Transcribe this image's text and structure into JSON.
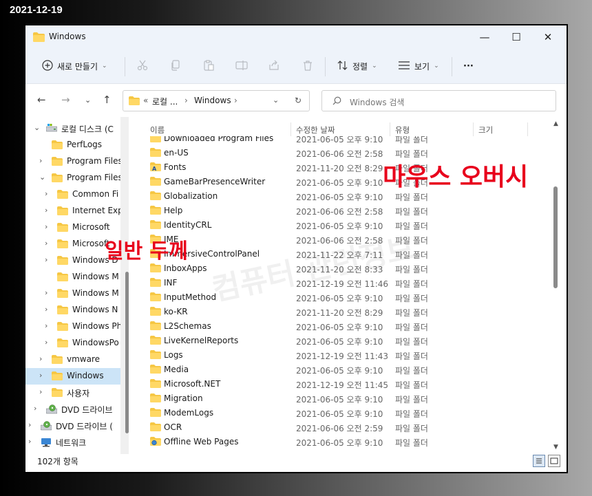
{
  "date_stamp": "2021-12-19",
  "window": {
    "title": "Windows",
    "controls": {
      "minimize": "—",
      "maximize": "☐",
      "close": "✕"
    }
  },
  "toolbar": {
    "new_label": "새로 만들기",
    "sort_label": "정렬",
    "view_label": "보기",
    "more_label": "···"
  },
  "address": {
    "overflow": "«",
    "parts": [
      "로컬 ...",
      "Windows"
    ],
    "search_placeholder": "Windows 검색"
  },
  "tree": [
    {
      "label": "로컬 디스크 (C",
      "icon": "drive-icon",
      "level": 0,
      "chev": "expanded"
    },
    {
      "label": "PerfLogs",
      "icon": "folder-icon",
      "level": 1,
      "chev": "none"
    },
    {
      "label": "Program Files",
      "icon": "folder-icon",
      "level": 1,
      "chev": "collapsed"
    },
    {
      "label": "Program Files",
      "icon": "folder-icon",
      "level": 1,
      "chev": "expanded"
    },
    {
      "label": "Common Fi",
      "icon": "folder-icon",
      "level": 2,
      "chev": "collapsed"
    },
    {
      "label": "Internet Exp",
      "icon": "folder-icon",
      "level": 2,
      "chev": "collapsed"
    },
    {
      "label": "Microsoft",
      "icon": "folder-icon",
      "level": 2,
      "chev": "collapsed"
    },
    {
      "label": "Microsoft",
      "icon": "folder-icon",
      "level": 2,
      "chev": "collapsed"
    },
    {
      "label": "Windows D",
      "icon": "folder-icon",
      "level": 2,
      "chev": "collapsed"
    },
    {
      "label": "Windows M",
      "icon": "folder-icon",
      "level": 2,
      "chev": "none"
    },
    {
      "label": "Windows M",
      "icon": "folder-icon",
      "level": 2,
      "chev": "collapsed"
    },
    {
      "label": "Windows N",
      "icon": "folder-icon",
      "level": 2,
      "chev": "collapsed"
    },
    {
      "label": "Windows Ph",
      "icon": "folder-icon",
      "level": 2,
      "chev": "collapsed"
    },
    {
      "label": "WindowsPo",
      "icon": "folder-icon",
      "level": 2,
      "chev": "collapsed"
    },
    {
      "label": "vmware",
      "icon": "folder-icon",
      "level": 1,
      "chev": "collapsed"
    },
    {
      "label": "Windows",
      "icon": "folder-icon",
      "level": 1,
      "chev": "collapsed",
      "selected": true
    },
    {
      "label": "사용자",
      "icon": "folder-icon",
      "level": 1,
      "chev": "collapsed"
    },
    {
      "label": "DVD 드라이브",
      "icon": "dvd-icon",
      "level": 0,
      "chev": "collapsed"
    },
    {
      "label": "DVD 드라이브 (",
      "icon": "dvd-icon",
      "level": -1,
      "chev": "collapsed"
    },
    {
      "label": "네트워크",
      "icon": "network-icon",
      "level": -1,
      "chev": "collapsed"
    }
  ],
  "columns": {
    "name": "이름",
    "modified": "수정한 날짜",
    "type": "유형",
    "size": "크기"
  },
  "files": [
    {
      "name": "Downloaded Program Files",
      "date": "2021-06-05 오후 9:10",
      "type": "파일 폴더"
    },
    {
      "name": "en-US",
      "date": "2021-06-06 오전 2:58",
      "type": "파일 폴더"
    },
    {
      "name": "Fonts",
      "date": "2021-11-20 오전 8:29",
      "type": "파일 폴더",
      "icon": "fonts-folder-icon"
    },
    {
      "name": "GameBarPresenceWriter",
      "date": "2021-06-05 오후 9:10",
      "type": "파일 폴더"
    },
    {
      "name": "Globalization",
      "date": "2021-06-05 오후 9:10",
      "type": "파일 폴더"
    },
    {
      "name": "Help",
      "date": "2021-06-06 오전 2:58",
      "type": "파일 폴더"
    },
    {
      "name": "IdentityCRL",
      "date": "2021-06-05 오후 9:10",
      "type": "파일 폴더"
    },
    {
      "name": "IME",
      "date": "2021-06-06 오전 2:58",
      "type": "파일 폴더"
    },
    {
      "name": "ImmersiveControlPanel",
      "date": "2021-11-22 오후 7:11",
      "type": "파일 폴더"
    },
    {
      "name": "InboxApps",
      "date": "2021-11-20 오전 8:33",
      "type": "파일 폴더"
    },
    {
      "name": "INF",
      "date": "2021-12-19 오전 11:46",
      "type": "파일 폴더"
    },
    {
      "name": "InputMethod",
      "date": "2021-06-05 오후 9:10",
      "type": "파일 폴더"
    },
    {
      "name": "ko-KR",
      "date": "2021-11-20 오전 8:29",
      "type": "파일 폴더"
    },
    {
      "name": "L2Schemas",
      "date": "2021-06-05 오후 9:10",
      "type": "파일 폴더"
    },
    {
      "name": "LiveKernelReports",
      "date": "2021-06-05 오후 9:10",
      "type": "파일 폴더"
    },
    {
      "name": "Logs",
      "date": "2021-12-19 오전 11:43",
      "type": "파일 폴더"
    },
    {
      "name": "Media",
      "date": "2021-06-05 오후 9:10",
      "type": "파일 폴더"
    },
    {
      "name": "Microsoft.NET",
      "date": "2021-12-19 오전 11:45",
      "type": "파일 폴더"
    },
    {
      "name": "Migration",
      "date": "2021-06-05 오후 9:10",
      "type": "파일 폴더"
    },
    {
      "name": "ModemLogs",
      "date": "2021-06-05 오후 9:10",
      "type": "파일 폴더"
    },
    {
      "name": "OCR",
      "date": "2021-06-06 오전 2:59",
      "type": "파일 폴더"
    },
    {
      "name": "Offline Web Pages",
      "date": "2021-06-05 오후 9:10",
      "type": "파일 폴더",
      "icon": "web-folder-icon"
    }
  ],
  "status": {
    "item_count": "102개 항목"
  },
  "annotations": {
    "mouseover": "마우스 오버시",
    "normal_thickness": "일반 두께",
    "watermark": "컴퓨터 관련정보",
    "color": "#e8001c"
  },
  "colors": {
    "folder": "#f6c744",
    "selected": "#cce4f7",
    "titlebar": "#eef3fa"
  }
}
